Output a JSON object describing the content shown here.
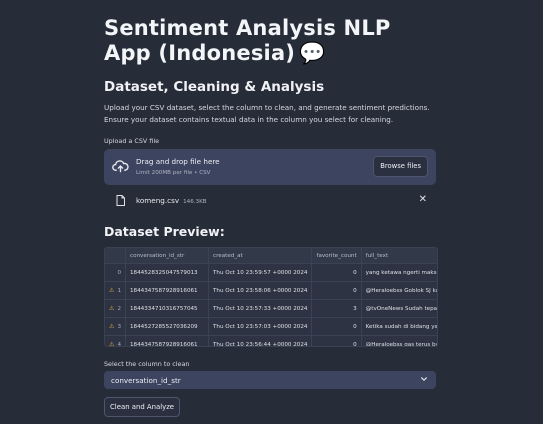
{
  "app": {
    "title": "Sentiment Analysis NLP App (Indonesia)",
    "title_emoji": "💬"
  },
  "section": {
    "heading": "Dataset, Cleaning & Analysis",
    "description": "Upload your CSV dataset, select the column to clean, and generate sentiment predictions. Ensure your dataset contains textual data in the column you select for cleaning."
  },
  "uploader": {
    "label": "Upload a CSV file",
    "drop_text": "Drag and drop file here",
    "limit_text": "Limit 200MB per file • CSV",
    "browse_label": "Browse files",
    "file_name": "komeng.csv",
    "file_size": "146.3KB"
  },
  "preview": {
    "heading": "Dataset Preview:",
    "columns": [
      "",
      "conversation_id_str",
      "created_at",
      "favorite_count",
      "full_text"
    ],
    "rows": [
      {
        "index": "0",
        "warn": false,
        "id": "1844528325047579013",
        "created_at": "Thu Oct 10 23:59:57 +0000 2024",
        "favorite_count": "0",
        "full_text": "yang ketawa ngerti maksud ko"
      },
      {
        "index": "1",
        "warn": true,
        "id": "1844347587928916061",
        "created_at": "Thu Oct 10 23:58:06 +0000 2024",
        "favorite_count": "0",
        "full_text": "@Heraloebss Goblok SJ kalau"
      },
      {
        "index": "2",
        "warn": true,
        "id": "1844334710316757045",
        "created_at": "Thu Oct 10 23:57:33 +0000 2024",
        "favorite_count": "3",
        "full_text": "@tvOneNews Sudah tepat pal"
      },
      {
        "index": "3",
        "warn": true,
        "id": "1844527285527036209",
        "created_at": "Thu Oct 10 23:57:03 +0000 2024",
        "favorite_count": "0",
        "full_text": "Ketika sudah di bidang yang l"
      },
      {
        "index": "4",
        "warn": true,
        "id": "1844347587928916061",
        "created_at": "Thu Oct 10 23:56:44 +0000 2024",
        "favorite_count": "0",
        "full_text": "@Heraloebss gas terus bang k"
      }
    ]
  },
  "column_select": {
    "label": "Select the column to clean",
    "value": "conversation_id_str"
  },
  "actions": {
    "clean_analyze_label": "Clean and Analyze"
  },
  "colors": {
    "background": "#262c38",
    "widget": "#3c4460",
    "warning": "#e8b339"
  },
  "icons": {
    "upload": "cloud-upload-icon",
    "file": "file-icon",
    "close": "close-icon",
    "dropdown": "chevron-down-icon",
    "row_warning": "warning-icon"
  }
}
